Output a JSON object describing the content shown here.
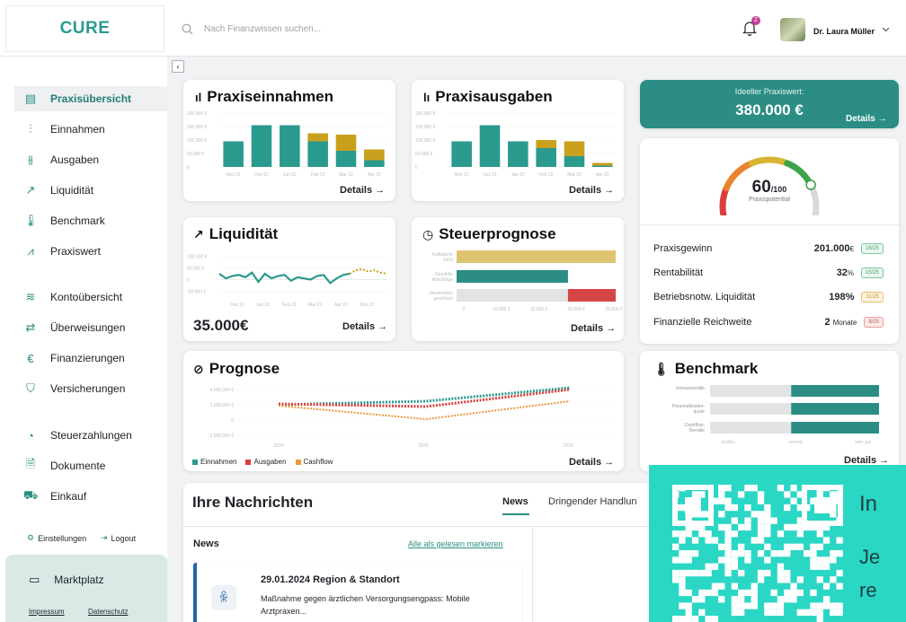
{
  "brand": {
    "logo": "CURE"
  },
  "header": {
    "search_placeholder": "Nach Finanzwissen suchen...",
    "notification_count": "2",
    "user_name": "Dr. Laura Müller"
  },
  "sidebar": {
    "items": [
      {
        "label": "Praxisübersicht",
        "icon": "layout-icon",
        "active": true
      },
      {
        "label": "Einnahmen",
        "icon": "income-icon"
      },
      {
        "label": "Ausgaben",
        "icon": "expenses-icon"
      },
      {
        "label": "Liquidität",
        "icon": "trend-icon"
      },
      {
        "label": "Benchmark",
        "icon": "thermometer-icon"
      },
      {
        "label": "Praxiswert",
        "icon": "pulse-icon"
      },
      {
        "label": "Kontoübersicht",
        "icon": "layers-icon"
      },
      {
        "label": "Überweisungen",
        "icon": "transfer-icon"
      },
      {
        "label": "Finanzierungen",
        "icon": "euro-doc-icon"
      },
      {
        "label": "Versicherungen",
        "icon": "shield-icon"
      },
      {
        "label": "Steuerzahlungen",
        "icon": "pie-icon"
      },
      {
        "label": "Dokumente",
        "icon": "document-icon"
      },
      {
        "label": "Einkauf",
        "icon": "cart-icon"
      }
    ],
    "settings": "Einstellungen",
    "logout": "Logout",
    "marketplace": "Marktplatz",
    "impressum": "Impressum",
    "datenschutz": "Datenschutz"
  },
  "einnahmen": {
    "title": "Praxiseinnahmen",
    "details": "Details →",
    "yticks": [
      "200.000 €",
      "150.000 €",
      "100.000 €",
      "50.000 €",
      "0"
    ],
    "chart_data": {
      "type": "bar",
      "categories": [
        "Nov 21",
        "Dez 21",
        "Jan 22",
        "Feb 22",
        "Mar 22",
        "Apr 22"
      ],
      "series": [
        {
          "values": [
            95000,
            155000,
            155000,
            95000,
            60000,
            25000
          ]
        },
        {
          "values": [
            0,
            0,
            0,
            30000,
            60000,
            40000
          ]
        }
      ],
      "ylim": [
        0,
        200000
      ]
    }
  },
  "ausgaben": {
    "title": "Praxisausgaben",
    "details": "Details →",
    "yticks": [
      "200.000 €",
      "150.000 €",
      "100.000 €",
      "50.000 €",
      "0"
    ],
    "chart_data": {
      "type": "bar",
      "categories": [
        "Nov 21",
        "Dez 21",
        "Jan 22",
        "Feb 22",
        "Mar 22",
        "Apr 22"
      ],
      "series": [
        {
          "values": [
            95000,
            155000,
            95000,
            70000,
            40000,
            5000
          ]
        },
        {
          "values": [
            0,
            0,
            0,
            30000,
            55000,
            10000
          ]
        }
      ],
      "ylim": [
        0,
        200000
      ]
    }
  },
  "praxiswert": {
    "label": "Ideeller Praxiswert:",
    "value": "380.000 €",
    "details": "Details →"
  },
  "gauge": {
    "value": "60",
    "max": "/100",
    "label": "Praxispotential",
    "fraction": 0.6
  },
  "kpis": [
    {
      "label": "Praxisgewinn",
      "value": "201.000",
      "unit": "€",
      "badge": "16/25",
      "tone": "green"
    },
    {
      "label": "Rentabilität",
      "value": "32",
      "unit": "%",
      "badge": "15/25",
      "tone": "green"
    },
    {
      "label": "Betriebsnotw. Liquidität",
      "value": "198%",
      "unit": "",
      "badge": "11/25",
      "tone": "orange"
    },
    {
      "label": "Finanzielle Reichweite",
      "value": "2",
      "unit": "Monate",
      "badge": "8/25",
      "tone": "red"
    }
  ],
  "liquiditaet": {
    "title": "Liquidität",
    "value": "35.000€",
    "details": "Details →",
    "yticks": [
      "100.000 €",
      "50.000 €",
      "0",
      "-50.000 €"
    ],
    "chart_data": {
      "type": "line",
      "x": [
        "Dez 21",
        "Jan 22",
        "Feb 22",
        "Mar 22",
        "Apr 22",
        "Mai 22"
      ],
      "ylim": [
        -60000,
        110000
      ],
      "series": [
        {
          "values": [
            25000,
            5000,
            15000,
            20000,
            10000,
            30000,
            -10000,
            25000,
            5000,
            15000,
            20000,
            -5000,
            10000,
            5000,
            0,
            15000,
            20000,
            -15000,
            5000,
            20000,
            25000
          ]
        },
        {
          "values": [
            25000,
            40000,
            45000,
            35000,
            40000,
            30000,
            25000
          ]
        }
      ]
    }
  },
  "steuer": {
    "title": "Steuerprognose",
    "details": "Details →",
    "chart_data": {
      "type": "bar",
      "categories": [
        "Kalkulierte EkSt",
        "Gezahlte Abschläge",
        "Steuersaldo geschätzt"
      ],
      "xticks": [
        "0",
        "10.000 €",
        "15.000 €",
        "20.000 €",
        "25.000 €"
      ]
    }
  },
  "prognose": {
    "title": "Prognose",
    "details": "Details →",
    "yticks": [
      "4.000.000 €",
      "2.000.000 €",
      "0",
      "-2.000.000 €"
    ],
    "xticks": [
      "2024",
      "2025",
      "2026"
    ],
    "legend": [
      {
        "label": "Einnahmen",
        "color": "#2b9a8e"
      },
      {
        "label": "Ausgaben",
        "color": "#d6403e"
      },
      {
        "label": "Cashflow",
        "color": "#e89a3c"
      }
    ]
  },
  "benchmark": {
    "title": "Benchmark",
    "details": "Details →",
    "categories": [
      "Umsatzrendite",
      "Personalkosten-quote",
      "Cashflow-Rendite"
    ],
    "scale": [
      "prüfen",
      "normal",
      "sehr gut"
    ]
  },
  "messages": {
    "title": "Ihre Nachrichten",
    "tabs": [
      "News",
      "Dringender Handlun"
    ],
    "section": "News",
    "mark_read": "Alle als gelesen markieren",
    "item": {
      "date": "29.01.2024 Region & Standort",
      "text": "Maßnahme gegen ärztlichen Versorgungsengpass: Mobile Arztpraxen..."
    }
  },
  "promo": {
    "title": "In",
    "text1": "Je",
    "text2": "re"
  }
}
